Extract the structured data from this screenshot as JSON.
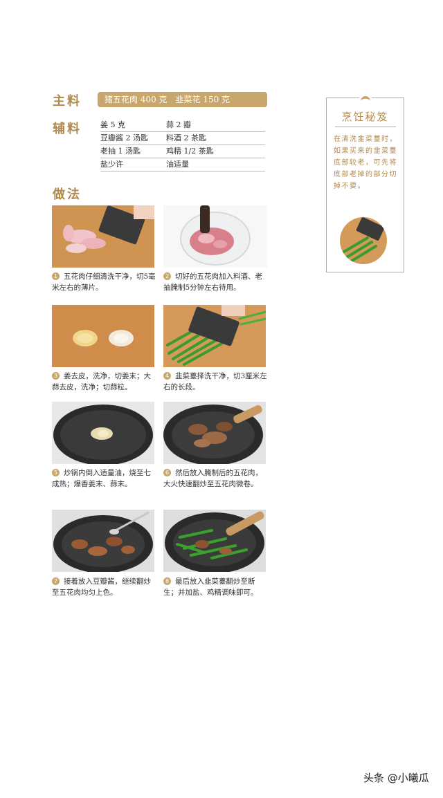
{
  "main_ingredients": {
    "heading": "主料",
    "items": "猪五花肉 400 克　韭菜花 150 克"
  },
  "aux_ingredients": {
    "heading": "辅料",
    "rows": [
      [
        "姜 5 克",
        "蒜 2 瓣"
      ],
      [
        "豆瓣酱 2 汤匙",
        "料酒 2 茶匙"
      ],
      [
        "老抽 1 汤匙",
        "鸡精 1/2 茶匙"
      ],
      [
        "盐少许",
        "油适量"
      ]
    ]
  },
  "method": {
    "heading": "做法",
    "steps": [
      {
        "num": "1",
        "text": "五花肉仔细清洗干净，切5毫米左右的薄片。"
      },
      {
        "num": "2",
        "text": "切好的五花肉加入料酒、老抽腌制5分钟左右待用。"
      },
      {
        "num": "3",
        "text": "姜去皮，洗净，切姜末；大蒜去皮，洗净；切蒜粒。"
      },
      {
        "num": "4",
        "text": "韭菜薹择洗干净，切3厘米左右的长段。"
      },
      {
        "num": "5",
        "text": "炒锅内倒入适量油，烧至七成热；爆香姜末、蒜末。"
      },
      {
        "num": "6",
        "text": "然后放入腌制后的五花肉，大火快速翻炒至五花肉微卷。"
      },
      {
        "num": "7",
        "text": "接着放入豆瓣酱，继续翻炒至五花肉均匀上色。"
      },
      {
        "num": "8",
        "text": "最后放入韭菜薹翻炒至断生；并加盐、鸡精调味即可。"
      }
    ]
  },
  "tip": {
    "title": "烹饪秘笈",
    "text": "在清洗韭菜薹时，如果买来的韭菜薹底部较老，可先将底部老掉的部分切掉不要。"
  },
  "watermark": "头条 @小曦瓜",
  "colors": {
    "accent": "#c8a66c",
    "heading": "#b08a4e"
  }
}
